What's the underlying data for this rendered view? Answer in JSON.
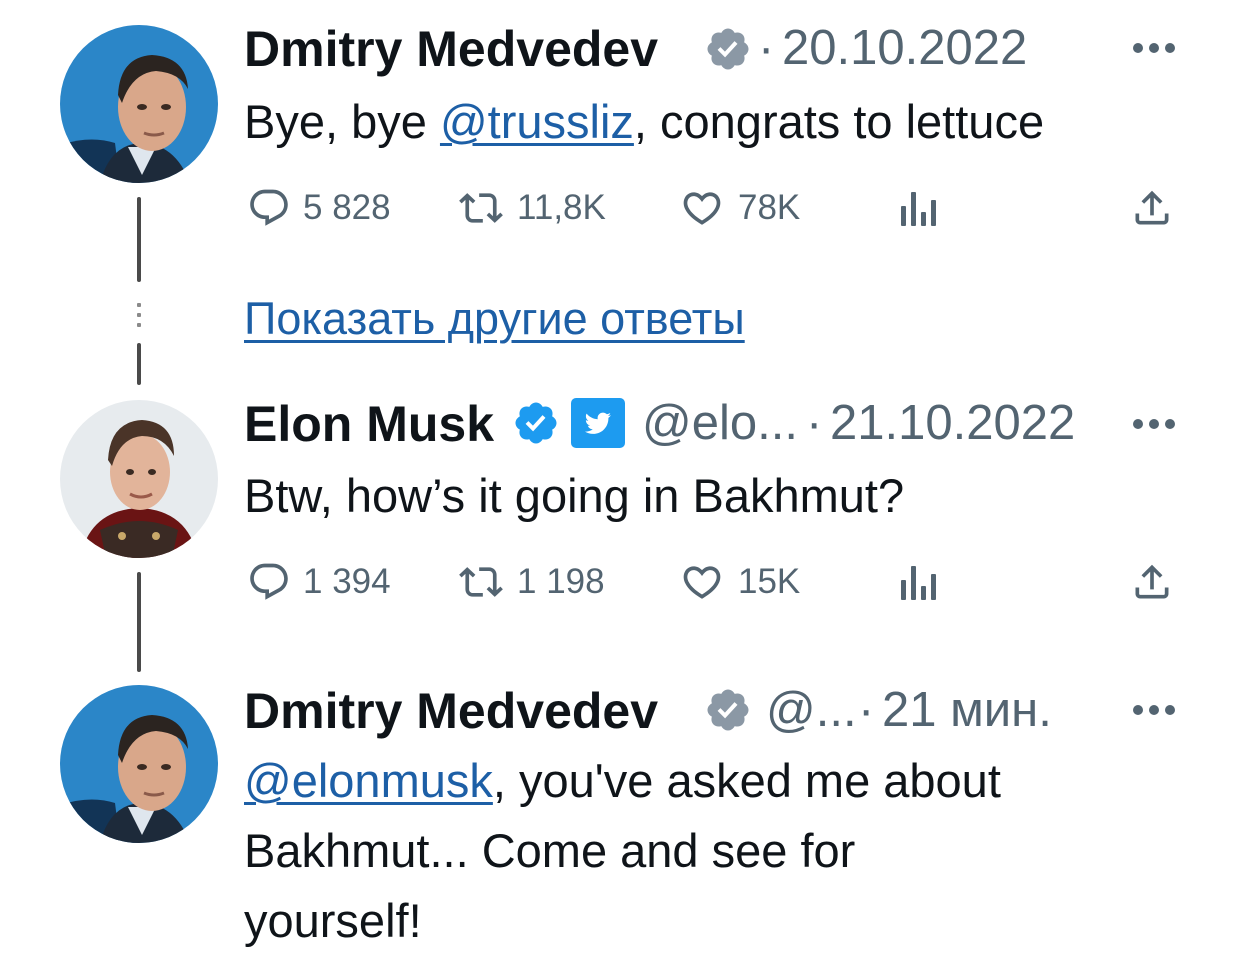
{
  "tweets": [
    {
      "name": "Dmitry Medvedev",
      "handle": "",
      "separator": "·",
      "date": "20.10.2022",
      "text_before": "Bye, bye ",
      "mention": "@trussliz",
      "text_after": ", congrats to lettuce",
      "stats": {
        "replies": "5 828",
        "retweets": "11,8K",
        "likes": "78K"
      }
    },
    {
      "name": "Elon Musk",
      "handle": "@elo...",
      "separator": "·",
      "date": "21.10.2022",
      "text": "Btw, how’s it going in Bakhmut?",
      "stats": {
        "replies": "1 394",
        "retweets": "1 198",
        "likes": "15K"
      }
    },
    {
      "name": "Dmitry Medvedev",
      "handle": "@...",
      "separator": "·",
      "date": "21 мин.",
      "mention": "@elonmusk",
      "line1_after": ", you've asked me about",
      "line2": "Bakhmut... Come and see for",
      "line3": "yourself!"
    }
  ],
  "show_more_replies": "Показать другие ответы",
  "icons": [
    "verified-badge-icon",
    "more-icon",
    "reply-icon",
    "retweet-icon",
    "like-icon",
    "views-icon",
    "share-icon",
    "twitter-logo-icon"
  ],
  "colors": {
    "link": "#1d5fa6",
    "muted": "#536471",
    "verified_gray": "#8b98a5",
    "verified_blue": "#1d9bf0"
  }
}
